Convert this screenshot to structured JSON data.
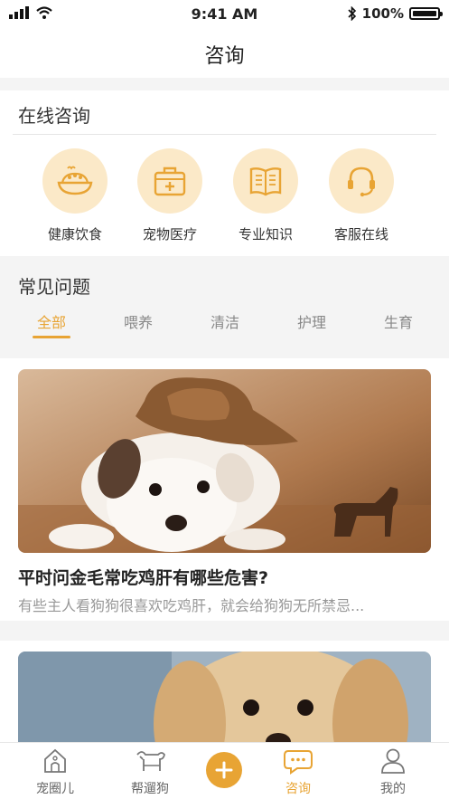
{
  "status_bar": {
    "time": "9:41 AM",
    "battery": "100%"
  },
  "header": {
    "title": "咨询"
  },
  "consult": {
    "title": "在线咨询",
    "categories": [
      {
        "label": "健康饮食",
        "icon": "food-bowl-icon"
      },
      {
        "label": "宠物医疗",
        "icon": "medical-kit-icon"
      },
      {
        "label": "专业知识",
        "icon": "book-icon"
      },
      {
        "label": "客服在线",
        "icon": "headset-icon"
      }
    ]
  },
  "faq": {
    "title": "常见问题",
    "tabs": [
      "全部",
      "喂养",
      "清洁",
      "护理",
      "生育"
    ],
    "active_tab": "全部"
  },
  "articles": [
    {
      "title": "平时问金毛常吃鸡肝有哪些危害?",
      "summary": "有些主人看狗狗很喜欢吃鸡肝，就会给狗狗无所禁忌..."
    },
    {
      "title": "",
      "summary": ""
    }
  ],
  "tabbar": {
    "items": [
      {
        "label": "宠圈儿",
        "icon": "house-icon"
      },
      {
        "label": "帮遛狗",
        "icon": "dog-icon"
      },
      {
        "label": "",
        "icon": "plus-icon"
      },
      {
        "label": "咨询",
        "icon": "chat-icon"
      },
      {
        "label": "我的",
        "icon": "user-icon"
      }
    ],
    "active": "咨询"
  },
  "colors": {
    "accent": "#e8a434",
    "icon_bg": "#fbe9c8",
    "background": "#f4f4f4"
  }
}
